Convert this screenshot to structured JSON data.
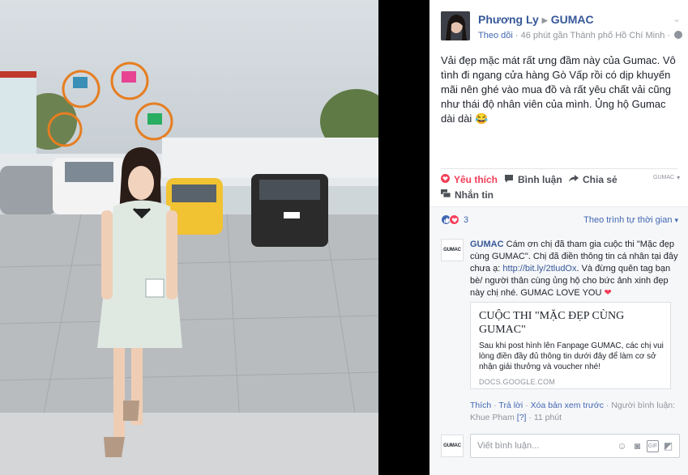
{
  "post": {
    "author": "Phương Ly",
    "page": "GUMAC",
    "follow": "Theo dõi",
    "meta": " · 46 phút gần Thành phố Hồ Chí Minh · ",
    "text": "Vải đẹp mặc mát rất ưng đầm này của Gumac. Vô tình đi ngang cửa hàng Gò Vấp rồi có dịp khuyến mãi nên ghé vào mua đồ và rất yêu chất vải cũng như thái độ nhân viên của mình. Ủng hộ Gumac dài dài",
    "emoji": "😂"
  },
  "actions": {
    "like": "Yêu thích",
    "comment": "Bình luận",
    "share": "Chia sẻ",
    "page_label": "GUMAC",
    "message": "Nhắn tin"
  },
  "reactions": {
    "count": "3",
    "sort": "Theo trình tự thời gian"
  },
  "comment": {
    "avatar_text": "GUMAC",
    "author": "GUMAC",
    "text_1": " Cám ơn chị đã tham gia cuộc thi \"Mặc đẹp cùng GUMAC\". Chị đã điền thông tin cá nhân tại đây chưa ạ: ",
    "link": "http://bit.ly/2tludOx",
    "text_2": ". Và đừng quên tag bạn bè/ người thân cùng ủng hộ cho bức ảnh xinh đẹp này chị nhé. GUMAC LOVE YOU ",
    "heart": "❤",
    "preview": {
      "title": "CUỘC THI \"MẶC ĐẸP CÙNG GUMAC\"",
      "desc": "Sau khi post hình lên Fanpage GUMAC, các chị vui lòng điền đầy đủ thông tin dưới đây để làm cơ sở nhận giải thưởng và voucher nhé!",
      "url": "DOCS.GOOGLE.COM"
    },
    "footer": {
      "like": "Thích",
      "reply": "Trả lời",
      "preview_remove": "Xóa bản xem trước",
      "author_note": "Người bình luận: Khue Pham",
      "help": "[?]",
      "time": "11 phút"
    }
  },
  "reply": {
    "avatar_text": "GUMAC",
    "placeholder": "Viết bình luận..."
  }
}
